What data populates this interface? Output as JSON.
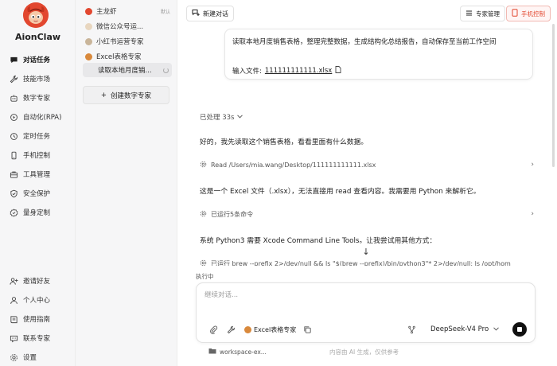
{
  "nav": {
    "brand": "AionClaw",
    "items": [
      {
        "label": "对话任务",
        "icon": "chat-icon"
      },
      {
        "label": "技能市场",
        "icon": "wrench-icon"
      },
      {
        "label": "数字专家",
        "icon": "robot-icon"
      },
      {
        "label": "自动化(RPA)",
        "icon": "automation-icon"
      },
      {
        "label": "定时任务",
        "icon": "clock-icon"
      },
      {
        "label": "手机控制",
        "icon": "phone-icon"
      },
      {
        "label": "工具管理",
        "icon": "toolbox-icon"
      },
      {
        "label": "安全保护",
        "icon": "shield-icon"
      },
      {
        "label": "量身定制",
        "icon": "badge-icon"
      }
    ],
    "bottom_items": [
      {
        "label": "邀请好友",
        "icon": "invite-icon"
      },
      {
        "label": "个人中心",
        "icon": "user-icon"
      },
      {
        "label": "使用指南",
        "icon": "book-icon"
      },
      {
        "label": "联系专家",
        "icon": "contact-icon"
      },
      {
        "label": "设置",
        "icon": "gear-icon"
      }
    ]
  },
  "sessions": {
    "items": [
      {
        "label": "主龙虾",
        "tag": "默认"
      },
      {
        "label": "微信公众号运..."
      },
      {
        "label": "小红书运营专家"
      },
      {
        "label": "Excel表格专家"
      },
      {
        "label": "读取本地月度销..."
      }
    ],
    "create_label": "创建数字专家"
  },
  "header": {
    "new_chat": "新建对话",
    "expert_manage": "专家管理",
    "phone_control": "手机控制"
  },
  "user_message": {
    "text": "读取本地月度销售表格，整理完整数据，生成结构化总结报告，自动保存至当前工作空间",
    "file_prefix": "输入文件:",
    "file_name": "111111111111.xlsx"
  },
  "assistant": {
    "processed": "已处理 33s",
    "msg1": "好的，我先读取这个销售表格，看看里面有什么数据。",
    "tool1": "Read /Users/mia.wang/Desktop/111111111111.xlsx",
    "msg2": "这是一个 Excel 文件（.xlsx），无法直接用 read 查看内容。我需要用 Python 来解析它。",
    "tool2": "已运行5条命令",
    "msg3": "系统 Python3 需要 Xcode Command Line Tools。让我尝试用其他方式：",
    "tool3": "已运行 brew --prefix 2>/dev/null && ls \"$(brew --prefix)/bin/python3\"* 2>/dev/null; ls /opt/hom"
  },
  "composer": {
    "running": "执行中",
    "placeholder": "继续对话...",
    "expert": "Excel表格专家",
    "model": "DeepSeek-V4 Pro"
  },
  "footer": {
    "workspace": "workspace-ex...",
    "disclaimer": "内容由 AI 生成，仅供参考"
  },
  "colors": {
    "accent": "#e2472f",
    "nav_bg": "#f6f6f7",
    "active_bg": "#e8e8ea"
  }
}
